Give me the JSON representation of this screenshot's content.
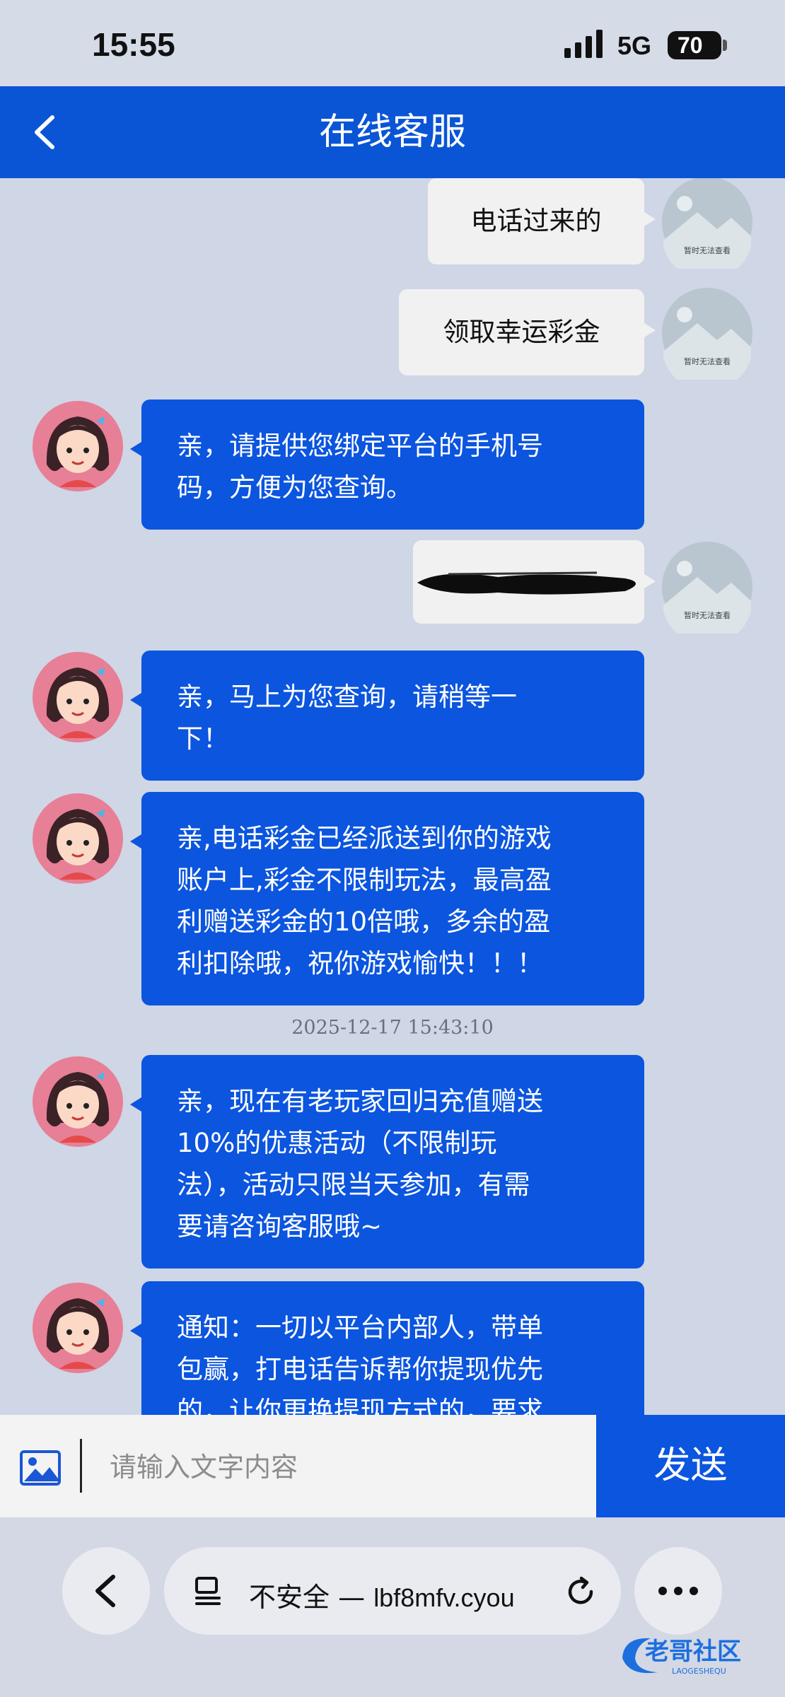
{
  "status_bar": {
    "time": "15:55",
    "network": "5G",
    "battery": "70"
  },
  "header": {
    "title": "在线客服",
    "back_icon": "chevron-left-icon"
  },
  "messages": [
    {
      "sender": "user",
      "text": "电话过来的",
      "avatar_caption": "暂时无法查看"
    },
    {
      "sender": "user",
      "text": "领取幸运彩金",
      "avatar_caption": "暂时无法查看"
    },
    {
      "sender": "agent",
      "lines": [
        "亲，请提供您绑定平台的手机号",
        "码，方便为您查询。"
      ]
    },
    {
      "sender": "user",
      "text": "",
      "redacted": true,
      "avatar_caption": "暂时无法查看"
    },
    {
      "sender": "agent",
      "lines": [
        "亲，马上为您查询，请稍等一",
        "下！"
      ]
    },
    {
      "sender": "agent",
      "lines": [
        "亲,电话彩金已经派送到你的游戏",
        "账户上,彩金不限制玩法，最高盈",
        "利赠送彩金的10倍哦，多余的盈",
        "利扣除哦，祝你游戏愉快！！！"
      ]
    },
    {
      "sender": "agent",
      "lines": [
        "亲，现在有老玩家回归充值赠送",
        "10%的优惠活动（不限制玩",
        "法），活动只限当天参加，有需",
        "要请咨询客服哦~"
      ]
    },
    {
      "sender": "agent",
      "lines": [
        "通知：一切以平台内部人，带单",
        "包赢，打电话告诉帮你提现优先",
        "的，让你更换提现方式的，要求"
      ]
    }
  ],
  "timestamp": "2025-12-17 15:43:10",
  "input": {
    "placeholder": "请输入文字内容",
    "send_label": "发送"
  },
  "browser": {
    "security": "不安全 —",
    "domain": "lbf8mfv.cyou"
  },
  "watermark": {
    "text": "老哥社区",
    "subtext": "LAOGESHEQU"
  },
  "colors": {
    "primary": "#0b55df",
    "background": "#cfd6e6"
  }
}
